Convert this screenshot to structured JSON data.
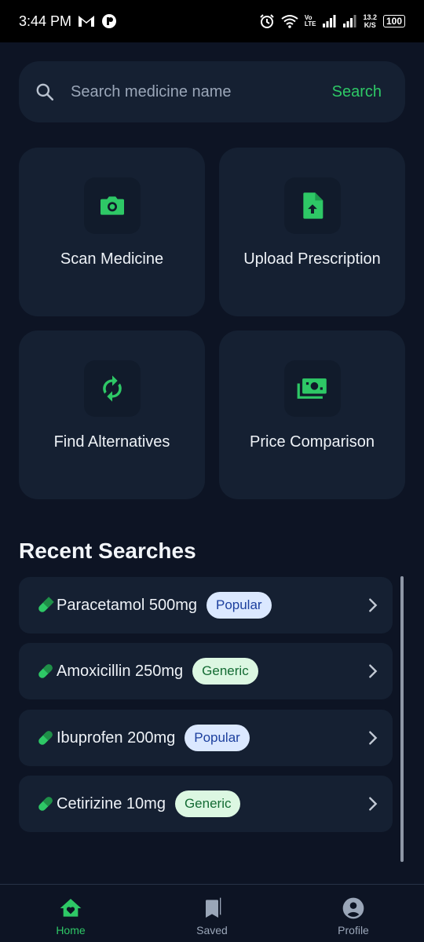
{
  "status_bar": {
    "time": "3:44 PM",
    "volte_top": "Vo",
    "volte_bottom": "LTE",
    "net_speed_value": "13.2",
    "net_speed_unit": "K/S",
    "battery": "100"
  },
  "search": {
    "placeholder": "Search medicine name",
    "button_label": "Search"
  },
  "cards": [
    {
      "label": "Scan Medicine",
      "icon": "camera-icon"
    },
    {
      "label": "Upload Prescription",
      "icon": "file-upload-icon"
    },
    {
      "label": "Find Alternatives",
      "icon": "sync-icon"
    },
    {
      "label": "Price Comparison",
      "icon": "money-icon"
    }
  ],
  "recent": {
    "title": "Recent Searches",
    "items": [
      {
        "name": "Paracetamol 500mg",
        "badge": "Popular",
        "badge_type": "popular"
      },
      {
        "name": "Amoxicillin 250mg",
        "badge": "Generic",
        "badge_type": "generic"
      },
      {
        "name": "Ibuprofen 200mg",
        "badge": "Popular",
        "badge_type": "popular"
      },
      {
        "name": "Cetirizine 10mg",
        "badge": "Generic",
        "badge_type": "generic"
      }
    ]
  },
  "nav": {
    "items": [
      {
        "label": "Home",
        "icon": "home-heart-icon",
        "active": true
      },
      {
        "label": "Saved",
        "icon": "bookmarks-icon",
        "active": false
      },
      {
        "label": "Profile",
        "icon": "account-circle-icon",
        "active": false
      }
    ]
  },
  "colors": {
    "background": "#0d1424",
    "surface": "#152032",
    "accent": "#2ec866",
    "popular_bg": "#dbe8ff",
    "generic_bg": "#dcf7e2"
  }
}
